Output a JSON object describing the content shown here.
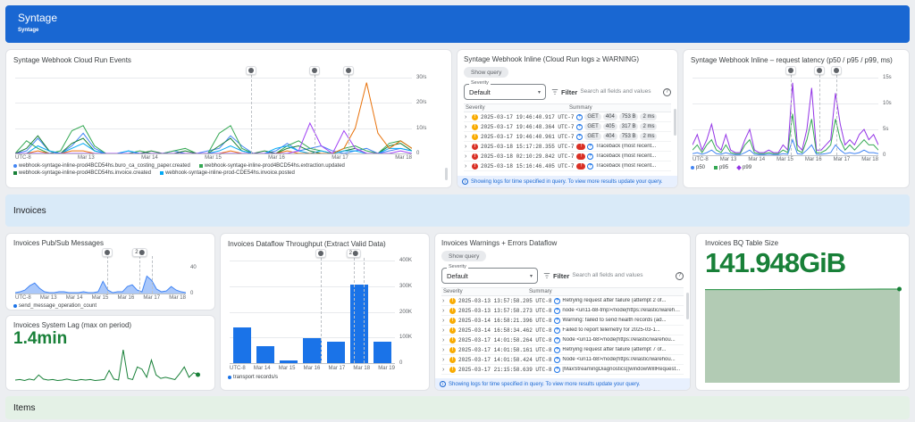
{
  "header": {
    "title": "Syntage",
    "subtitle": "Syntage"
  },
  "sections": {
    "invoices": "Invoices",
    "items": "Items"
  },
  "colors": {
    "header_blue": "#1967d2",
    "section_invoices_bg": "#d9eaf8",
    "section_items_bg": "#e4f1e6",
    "metric_green": "#188038",
    "bar_blue": "#1a73e8",
    "warning_yellow": "#f9ab00",
    "error_red": "#d93025"
  },
  "logs_webhook": {
    "title": "Syntage Webhook Inline (Cloud Run logs ≥ WARNING)",
    "show_query": "Show query",
    "severity_label": "Severity",
    "severity_value": "Default",
    "filter_label": "Filter",
    "search_placeholder": "Search all fields and values",
    "columns": [
      "Severity",
      "Summary"
    ],
    "rows": [
      {
        "severity": "warning",
        "time": "2025-03-17 19:46:40.917 UTC-7",
        "chips": [
          "GET",
          "404",
          "753 B",
          "2 ms"
        ]
      },
      {
        "severity": "warning",
        "time": "2025-03-17 19:46:48.364 UTC-7",
        "chips": [
          "GET",
          "405",
          "317 B",
          "2 ms"
        ]
      },
      {
        "severity": "warning",
        "time": "2025-03-17 19:46:40.961 UTC-7",
        "chips": [
          "GET",
          "404",
          "753 B",
          "2 ms"
        ]
      },
      {
        "severity": "error",
        "time": "2025-03-18 15:17:28.355 UTC-7",
        "summary": "Traceback (most recent..."
      },
      {
        "severity": "error",
        "time": "2025-03-18 02:10:29.842 UTC-7",
        "summary": "Traceback (most recent..."
      },
      {
        "severity": "error",
        "time": "2025-03-18 15:16:46.405 UTC-7",
        "summary": "Traceback (most recent..."
      }
    ],
    "footer": "Showing logs for time specified in query. To view more results update your query."
  },
  "logs_invoices": {
    "title": "Invoices Warnings + Errors Dataflow",
    "show_query": "Show query",
    "severity_label": "Severity",
    "severity_value": "Default",
    "filter_label": "Filter",
    "search_placeholder": "Search all fields and values",
    "columns": [
      "Severity",
      "Summary"
    ],
    "rows": [
      {
        "severity": "warning",
        "time": "2025-03-13 13:57:58.205 UTC-8",
        "summary": "Retrying request after failure (attempt 2 of..."
      },
      {
        "severity": "warning",
        "time": "2025-03-13 13:57:58.273 UTC-8",
        "summary": "node <uri11-b8-tmp>/node(https://elastic/warehou..."
      },
      {
        "severity": "warning",
        "time": "2025-03-14 16:58:21.396 UTC-8",
        "summary": "Warning: failed to send health records (ad..."
      },
      {
        "severity": "warning",
        "time": "2025-03-14 16:58:34.462 UTC-8",
        "summary": "Failed to report telemetry for 2025-03-1..."
      },
      {
        "severity": "warning",
        "time": "2025-03-17 14:01:58.264 UTC-8",
        "summary": "Node <uri11-b8>/node(https://elastic/warehou..."
      },
      {
        "severity": "warning",
        "time": "2025-03-17 14:01:58.161 UTC-8",
        "summary": "Retrying request after failure (attempt 7 of..."
      },
      {
        "severity": "warning",
        "time": "2025-03-17 14:01:58.424 UTC-8",
        "summary": "Node <uri11-b8>/node(https://elastic/warehou..."
      },
      {
        "severity": "warning",
        "time": "2025-03-17 21:15:58.639 UTC-8",
        "summary": "[MaxStreamingDiagnostics][windowWillRequest..."
      }
    ],
    "footer": "Showing logs for time specified in query. To view more results update your query."
  },
  "chart_data": [
    {
      "id": "cloud_run_events",
      "type": "line",
      "title": "Syntage Webhook Cloud Run Events",
      "ylim": [
        0,
        30
      ],
      "y_ticks": [
        {
          "label": "30/s",
          "pct": 0
        },
        {
          "label": "20/s",
          "pct": 33.3
        },
        {
          "label": "10/s",
          "pct": 66.7
        },
        {
          "label": "0",
          "pct": 100,
          "line": false
        }
      ],
      "x_ticks": [
        "UTC-8",
        "Mar 13",
        "Mar 14",
        "Mar 15",
        "Mar 16",
        "Mar 17",
        "Mar 18"
      ],
      "event_markers": [
        {
          "x_pct": 59.5
        },
        {
          "x_pct": 75.5
        },
        {
          "x_pct": 84
        }
      ],
      "series": [
        {
          "name": "blue",
          "color": "#4285f4",
          "values": [
            0,
            1,
            6,
            1,
            0,
            3,
            8,
            2,
            0,
            0,
            1,
            0,
            0,
            0,
            1,
            0,
            0,
            1,
            2,
            7,
            3,
            0,
            0,
            1,
            4,
            1,
            2,
            3,
            1,
            0,
            1,
            2,
            0,
            1,
            2,
            1
          ]
        },
        {
          "name": "green",
          "color": "#34a853",
          "values": [
            0,
            5,
            2,
            0,
            1,
            9,
            11,
            3,
            0,
            0,
            0,
            1,
            0,
            0,
            1,
            2,
            0,
            0,
            8,
            11,
            2,
            0,
            0,
            0,
            3,
            5,
            2,
            1,
            0,
            2,
            3,
            1,
            0,
            4,
            5,
            2
          ]
        },
        {
          "name": "dark-green",
          "color": "#188038",
          "values": [
            0,
            2,
            7,
            1,
            0,
            4,
            6,
            1,
            0,
            0,
            0,
            0,
            1,
            0,
            0,
            1,
            0,
            0,
            3,
            6,
            1,
            0,
            1,
            0,
            2,
            3,
            1,
            0,
            0,
            1,
            2,
            0,
            0,
            3,
            4,
            1
          ]
        },
        {
          "name": "light-blue",
          "color": "#03a9f4",
          "values": [
            0,
            0,
            3,
            1,
            0,
            2,
            4,
            1,
            0,
            0,
            1,
            0,
            0,
            0,
            0,
            0,
            0,
            0,
            1,
            3,
            1,
            0,
            0,
            2,
            3,
            1,
            0,
            1,
            0,
            1,
            1,
            0,
            0,
            2,
            2,
            1
          ]
        },
        {
          "name": "orange",
          "color": "#e8710a",
          "values": [
            0,
            0,
            1,
            0,
            0,
            1,
            1,
            0,
            0,
            0,
            0,
            0,
            0,
            0,
            0,
            0,
            0,
            0,
            0,
            1,
            0,
            0,
            0,
            0,
            1,
            0,
            0,
            0,
            0,
            2,
            10,
            28,
            8,
            2,
            5,
            2
          ]
        },
        {
          "name": "purple",
          "color": "#a142f4",
          "values": [
            0,
            0,
            0,
            0,
            0,
            0,
            0,
            0,
            0,
            0,
            0,
            0,
            0,
            0,
            0,
            0,
            0,
            0,
            0,
            0,
            0,
            0,
            0,
            0,
            0,
            1,
            12,
            3,
            0,
            9,
            2,
            0,
            0,
            0,
            1,
            0
          ]
        }
      ],
      "legend": [
        {
          "name": "webhook-syntage-inline-prod4BCD54hs.buro_ca_costing_paper.created",
          "color": "#4285f4",
          "shape": "circle"
        },
        {
          "name": "webhook-syntage-inline-prod4BCD54hs.extraction.updated",
          "color": "#34a853",
          "shape": "square"
        },
        {
          "name": "webhook-syntage-inline-prod4BCD54hs.invoice.created",
          "color": "#188038",
          "shape": "square"
        },
        {
          "name": "webhook-syntage-inline-prod-CDE54hs.invoice.posted",
          "color": "#03a9f4",
          "shape": "square"
        }
      ]
    },
    {
      "id": "latency",
      "type": "line",
      "title": "Syntage Webhook Inline – request latency (p50 / p95 / p99, ms)",
      "ylim": [
        0,
        15
      ],
      "y_ticks": [
        {
          "label": "15s",
          "pct": 0
        },
        {
          "label": "10s",
          "pct": 33.3
        },
        {
          "label": "5s",
          "pct": 66.7
        },
        {
          "label": "0",
          "pct": 100,
          "line": false
        }
      ],
      "x_ticks": [
        "UTC-8",
        "Mar 13",
        "Mar 14",
        "Mar 15",
        "Mar 16",
        "Mar 17",
        "Mar 18"
      ],
      "event_markers": [
        {
          "x_pct": 53
        },
        {
          "x_pct": 68.5
        },
        {
          "x_pct": 77.5
        }
      ],
      "series": [
        {
          "name": "p99",
          "color": "#9334e6",
          "values": [
            2,
            4,
            1,
            3,
            6,
            2,
            1,
            4,
            1,
            0.5,
            0.5,
            3,
            5,
            1,
            0.5,
            0.5,
            1,
            0.5,
            0.5,
            2,
            1,
            14,
            2,
            1,
            5,
            13,
            1,
            1,
            2,
            3,
            12,
            6,
            2,
            3,
            2,
            4,
            5,
            3,
            4,
            2
          ]
        },
        {
          "name": "p95",
          "color": "#34a853",
          "values": [
            1,
            2,
            0.5,
            2,
            3,
            1,
            0.5,
            2,
            0.5,
            0.3,
            0.3,
            2,
            3,
            0.5,
            0.3,
            0.3,
            0.5,
            0.3,
            0.3,
            1,
            0.5,
            8,
            1,
            0.5,
            3,
            7,
            0.5,
            0.5,
            1,
            2,
            7,
            3,
            1,
            2,
            1,
            2,
            3,
            2,
            2,
            1
          ]
        },
        {
          "name": "p50",
          "color": "#4285f4",
          "values": [
            0.3,
            0.5,
            0.2,
            0.5,
            1,
            0.3,
            0.2,
            0.5,
            0.2,
            0.1,
            0.1,
            0.5,
            1,
            0.2,
            0.1,
            0.1,
            0.2,
            0.1,
            0.1,
            0.3,
            0.2,
            3,
            0.3,
            0.2,
            1,
            2,
            0.2,
            0.2,
            0.3,
            0.5,
            2,
            1,
            0.3,
            0.5,
            0.3,
            0.5,
            1,
            0.5,
            0.5,
            0.3
          ]
        }
      ],
      "legend": [
        {
          "name": "p50",
          "color": "#4285f4",
          "shape": "circle"
        },
        {
          "name": "p95",
          "color": "#34a853",
          "shape": "square"
        },
        {
          "name": "p99",
          "color": "#9334e6",
          "shape": "diamond"
        }
      ]
    },
    {
      "id": "pubsub",
      "type": "area",
      "title": "Invoices Pub/Sub Messages",
      "ylim": [
        0,
        40
      ],
      "y_ticks": [
        {
          "label": "40",
          "pct": 25,
          "line": false
        },
        {
          "label": "0",
          "pct": 100,
          "line": false
        }
      ],
      "x_ticks": [
        "UTC-8",
        "Mar 13",
        "Mar 14",
        "Mar 15",
        "Mar 16",
        "Mar 17",
        "Mar 18"
      ],
      "event_markers": [
        {
          "x_pct": 54
        },
        {
          "x_pct": 73,
          "count": "2"
        },
        {
          "x_pct": 80,
          "line_only": true
        }
      ],
      "series": [
        {
          "name": "send_message_operation_count",
          "color": "#4285f4",
          "fill": "rgba(66,133,244,0.45)",
          "values": [
            1,
            2,
            4,
            9,
            12,
            6,
            2,
            1,
            1,
            2,
            2,
            1,
            1,
            1,
            2,
            1,
            1,
            2,
            14,
            4,
            1,
            2,
            2,
            8,
            10,
            4,
            2,
            20,
            15,
            5,
            2,
            3,
            8,
            4,
            2,
            1
          ]
        }
      ],
      "legend": [
        {
          "name": "send_message_operation_count",
          "color": "#1a73e8",
          "shape": "circle"
        }
      ]
    },
    {
      "id": "system_lag",
      "type": "line",
      "title": "Invoices System Lag (max on period)",
      "big_value": {
        "value": "1.4",
        "unit": "min"
      },
      "ylim": [
        0,
        1.4
      ],
      "y_ticks": [],
      "x_ticks": [],
      "end_dot": true,
      "series": [
        {
          "name": "system_lag_max",
          "color": "#188038",
          "values": [
            0.08,
            0.1,
            0.06,
            0.12,
            0.08,
            0.3,
            0.12,
            0.08,
            0.1,
            0.06,
            0.08,
            0.12,
            0.08,
            0.06,
            0.1,
            0.08,
            0.1,
            0.06,
            0.08,
            0.1,
            0.5,
            0.12,
            0.08,
            1.4,
            0.15,
            0.1,
            0.65,
            0.55,
            0.2,
            0.95,
            0.3,
            0.15,
            0.2,
            0.15,
            0.1,
            0.35,
            0.65,
            0.2,
            0.4,
            0.3
          ]
        }
      ]
    },
    {
      "id": "throughput",
      "type": "bar",
      "title": "Invoices Dataflow Throughput (Extract Valid Data)",
      "ylim": [
        0,
        400000
      ],
      "y_ticks": [
        {
          "label": "400K",
          "pct": 0
        },
        {
          "label": "300K",
          "pct": 25
        },
        {
          "label": "200K",
          "pct": 50
        },
        {
          "label": "100K",
          "pct": 75
        },
        {
          "label": "0",
          "pct": 100,
          "line": false
        }
      ],
      "x_ticks": [
        "UTC-8",
        "Mar 14",
        "Mar 15",
        "Mar 16",
        "Mar 17",
        "Mar 18",
        "Mar 19"
      ],
      "categories": [
        "UTC-8",
        "Mar 14",
        "Mar 15",
        "Mar 16",
        "Mar 17",
        "Mar 18",
        "Mar 19"
      ],
      "values": [
        138000,
        65000,
        12000,
        98000,
        85000,
        305000,
        85000
      ],
      "event_markers": [
        {
          "x_pct": 55
        },
        {
          "x_pct": 75,
          "count": "2"
        },
        {
          "x_pct": 81,
          "line_only": true
        }
      ],
      "legend": [
        {
          "name": "transport records/s",
          "color": "#1a73e8",
          "shape": "circle"
        }
      ]
    },
    {
      "id": "bq_size",
      "type": "area",
      "title": "Invoices BQ Table Size",
      "big_value": {
        "value": "141.948",
        "unit": "GiB"
      },
      "ylim": [
        0,
        150
      ],
      "y_ticks": [],
      "x_ticks": [],
      "end_dot": true,
      "series": [
        {
          "name": "bq_table_size_gib",
          "color": "#1e8e3e",
          "fill": "#b2cbb4",
          "values": [
            141.0,
            141.05,
            141.1,
            141.15,
            141.2,
            141.3,
            141.4,
            141.5,
            141.6,
            141.7,
            141.85,
            141.948
          ]
        }
      ]
    }
  ]
}
